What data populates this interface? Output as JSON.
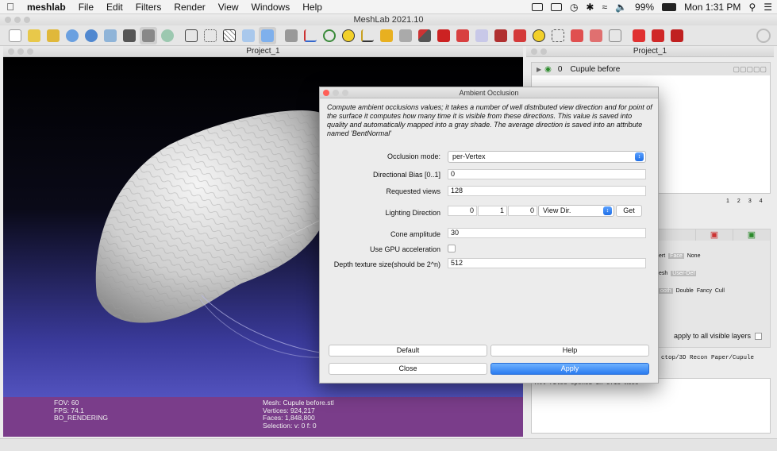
{
  "menubar": {
    "app_name": "meshlab",
    "items": [
      "File",
      "Edit",
      "Filters",
      "Render",
      "View",
      "Windows",
      "Help"
    ],
    "battery": "99%",
    "clock": "Mon 1:31 PM"
  },
  "window": {
    "title": "MeshLab 2021.10"
  },
  "viewport": {
    "title": "Project_1",
    "status_left": [
      "FOV: 60",
      "FPS:    74.1",
      "BO_RENDERING"
    ],
    "status_mesh": [
      "Mesh: Cupule before.stl",
      "Vertices: 924,217",
      "Faces: 1,848,800",
      "Selection: v: 0 f: 0"
    ]
  },
  "layers_panel": {
    "title": "Project_1",
    "layer_index": "0",
    "layer_name": "Cupule before",
    "pages": [
      "1",
      "2",
      "3",
      "4"
    ],
    "render_opts": {
      "row1": [
        "ert",
        "Face",
        "None"
      ],
      "row2": [
        "esh",
        "User-Def"
      ],
      "row3": [
        "ooth",
        "Double",
        "Fancy",
        "Cull"
      ]
    },
    "apply_all_label": "apply to all visible layers",
    "path_text": "ctop/3D Recon Paper/Cupule",
    "log_text": "All files opened in 5713 msec"
  },
  "dialog": {
    "title": "Ambient Occlusion",
    "description": "Compute ambient occlusions values; it takes a number of well distributed view direction and for point of the surface it computes how many time it is visible from these directions. This value is saved into quality and automatically mapped into a gray shade. The average direction is saved into an attribute named 'BentNormal'",
    "occlusion_mode_label": "Occlusion mode:",
    "occlusion_mode_value": "per-Vertex",
    "directional_bias_label": "Directional Bias [0..1]",
    "directional_bias_value": "0",
    "requested_views_label": "Requested views",
    "requested_views_value": "128",
    "lighting_direction_label": "Lighting Direction",
    "lighting_x": "0",
    "lighting_y": "1",
    "lighting_z": "0",
    "lighting_combo": "View Dir.",
    "get_label": "Get",
    "cone_amplitude_label": "Cone amplitude",
    "cone_amplitude_value": "30",
    "gpu_label": "Use GPU acceleration",
    "depth_label": "Depth texture size(should be 2^n)",
    "depth_value": "512",
    "default_label": "Default",
    "help_label": "Help",
    "close_label": "Close",
    "apply_label": "Apply"
  },
  "colors": {
    "viewport_top": "#000000",
    "viewport_bottom": "#6464d8",
    "status_band": "#7a3d8a",
    "accent_blue": "#2a7cf0"
  }
}
